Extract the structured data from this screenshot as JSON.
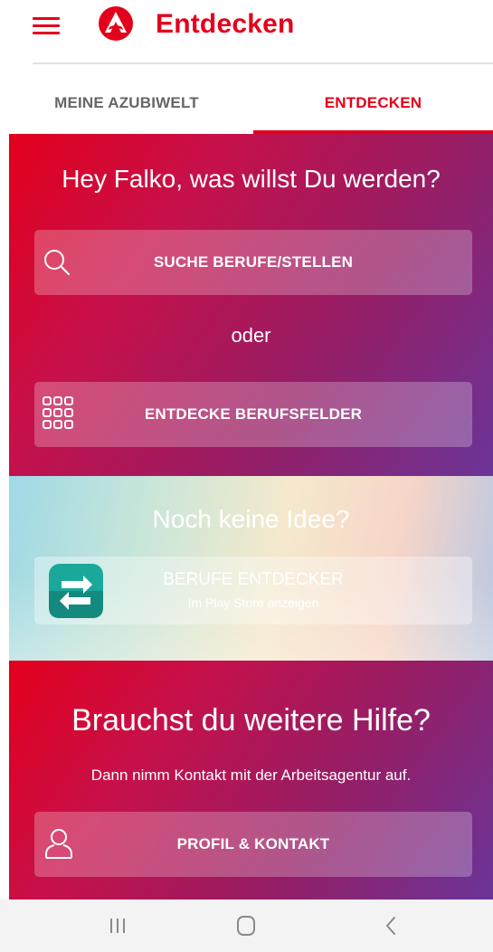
{
  "appbar": {
    "title": "Entdecken",
    "menu_icon": "hamburger-menu-icon",
    "logo_icon": "arbeitsagentur-logo-icon",
    "accent_color": "#e3001b"
  },
  "tabs": [
    {
      "label": "MEINE AZUBIWELT",
      "active": false
    },
    {
      "label": "ENTDECKEN",
      "active": true
    }
  ],
  "search_section": {
    "headline": "Hey Falko, was willst Du werden?",
    "search_button": {
      "label": "SUCHE BERUFE/STELLEN",
      "icon": "search-icon"
    },
    "separator": "oder",
    "explore_button": {
      "label": "ENTDECKE BERUFSFELDER",
      "icon": "grid-icon"
    }
  },
  "idea_section": {
    "headline": "Noch keine Idee?",
    "app_button": {
      "title": "BERUFE ENTDECKER",
      "subtitle": "Im Play Store anzeigen",
      "icon": "berufe-entdecker-app-icon"
    }
  },
  "help_section": {
    "headline": "Brauchst du weitere Hilfe?",
    "text": "Dann nimm Kontakt mit der Arbeitsagentur auf.",
    "contact_button": {
      "label": "PROFIL & KONTAKT",
      "icon": "person-icon"
    }
  },
  "system_nav": {
    "recents_icon": "recent-apps-icon",
    "home_icon": "home-icon",
    "back_icon": "back-icon"
  }
}
